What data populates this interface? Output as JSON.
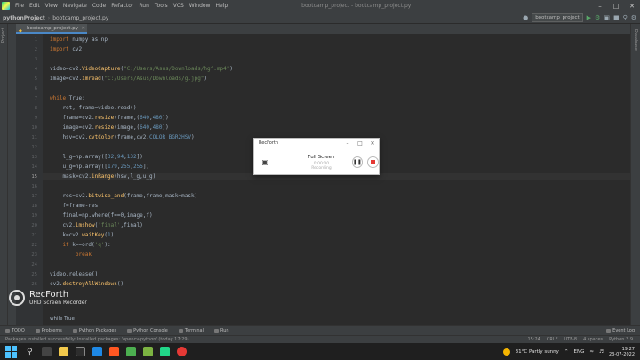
{
  "menubar": {
    "items": [
      "File",
      "Edit",
      "View",
      "Navigate",
      "Code",
      "Refactor",
      "Run",
      "Tools",
      "VCS",
      "Window",
      "Help"
    ],
    "window_title": "bootcamp_project - bootcamp_project.py"
  },
  "navbar": {
    "project": "pythonProject",
    "file": "bootcamp_project.py",
    "run_config": "bootcamp_project"
  },
  "tab": {
    "label": "bootcamp_project.py"
  },
  "left_strip_label": "Project",
  "right_strip_label": "Database",
  "gutter": {
    "line_numbers": [
      "1",
      "2",
      "3",
      "4",
      "5",
      "6",
      "7",
      "8",
      "9",
      "10",
      "11",
      "12",
      "13",
      "14",
      "15",
      "16",
      "17",
      "18",
      "19",
      "20",
      "21",
      "22",
      "23",
      "24",
      "25",
      "26",
      "27"
    ],
    "current": "15"
  },
  "code": {
    "l1_kw": "import",
    "l1_rest": " numpy as np",
    "l2_kw": "import",
    "l2_rest": " cv2",
    "l4_a": "video=cv2.",
    "l4_fn": "VideoCapture",
    "l4_b": "(",
    "l4_str": "\"C:/Users/Asus/Downloads/hgf.mp4\"",
    "l4_c": ")",
    "l5_a": "image=cv2.",
    "l5_fn": "imread",
    "l5_b": "(",
    "l5_str": "\"C:/Users/Asus/Downloads/g.jpg\"",
    "l5_c": ")",
    "l7_kw": "while",
    "l7_rest": " True:",
    "l8": "    ret, frame=video.read()",
    "l9_a": "    frame=cv2.",
    "l9_fn": "resize",
    "l9_b": "(frame,(",
    "l9_n1": "640",
    "l9_c": ",",
    "l9_n2": "480",
    "l9_d": "))",
    "l10_a": "    image=cv2.",
    "l10_fn": "resize",
    "l10_b": "(image,(",
    "l10_n1": "640",
    "l10_c": ",",
    "l10_n2": "480",
    "l10_d": "))",
    "l11_a": "    hsv=cv2.",
    "l11_fn": "cvtColor",
    "l11_b": "(frame,cv2.",
    "l11_c": "COLOR_BGR2HSV",
    "l11_d": ")",
    "l13_a": "    l_g=np.array([",
    "l13_n1": "32",
    "l13_c": ",",
    "l13_n2": "94",
    "l13_d": ",",
    "l13_n3": "132",
    "l13_e": "])",
    "l14_a": "    u_g=np.array([",
    "l14_n1": "179",
    "l14_c": ",",
    "l14_n2": "255",
    "l14_d": ",",
    "l14_n3": "255",
    "l14_e": "])",
    "l15_a": "    mask=cv2.",
    "l15_fn": "inRange",
    "l15_b": "(hsv,l_g,u_g)",
    "l17_a": "    res=cv2.",
    "l17_fn": "bitwise_and",
    "l17_b": "(frame,frame,mask=mask)",
    "l18": "    f=frame-res",
    "l19": "    final=np.where(f==0,image,f)",
    "l20_a": "    cv2.",
    "l20_fn": "imshow",
    "l20_b": "(",
    "l20_str": "'final'",
    "l20_c": ",final)",
    "l21_a": "    k=cv2.",
    "l21_fn": "waitKey",
    "l21_b": "(",
    "l21_n": "1",
    "l21_c": ")",
    "l22_kw": "    if",
    "l22_rest": " k==ord(",
    "l22_str": "'q'",
    "l22_c": "):",
    "l23_kw": "        break",
    "l25": "video.release()",
    "l26_a": "cv2.",
    "l26_fn": "destroyAllWindows",
    "l26_b": "()"
  },
  "editor_hint": "while True",
  "bottom_tabs": [
    "TODO",
    "Problems",
    "Python Packages",
    "Python Console",
    "Terminal",
    "Run"
  ],
  "event_log": "Event Log",
  "status": {
    "message": "Packages installed successfully: Installed packages: 'opencv-python' (today 17:29)",
    "position": "15:24",
    "line_sep": "CRLF",
    "encoding": "UTF-8",
    "indent": "4 spaces",
    "interpreter": "Python 3.9"
  },
  "taskbar": {
    "weather": "31°C  Partly sunny",
    "lang": "ENG",
    "time": "19:27",
    "date": "23-07-2022"
  },
  "recforth": {
    "title": "RecForth",
    "mode": "Full Screen",
    "timer": "0:00:00",
    "status": "Recording"
  },
  "watermark": {
    "name": "RecForth",
    "tagline": "UHD Screen Recorder"
  },
  "colors": {
    "editor_bg": "#2b2b2b",
    "keyword": "#cc7832",
    "string": "#6a8759",
    "number": "#6897bb",
    "function": "#ffc66d",
    "stop_button": "#e53935"
  }
}
